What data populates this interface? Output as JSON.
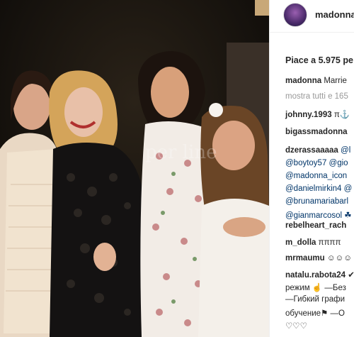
{
  "post": {
    "username": "madonna",
    "likes": "Piace a 5.975 pe",
    "caption_user": "madonna",
    "caption_text": "Marrie",
    "show_all": "mostra tutti e 165"
  },
  "comments": [
    {
      "user": "johnny.1993",
      "text": "π⚓"
    },
    {
      "user": "bigassmadonna",
      "text": ""
    },
    {
      "user": "dzerassaaaaa",
      "text": "@l"
    },
    {
      "user": "",
      "text": "@boytoy57 @gio"
    },
    {
      "user": "",
      "text": "@madonna_icon"
    },
    {
      "user": "",
      "text": "@danielmirkin4 @"
    },
    {
      "user": "",
      "text": "@brunamariabarl"
    },
    {
      "user": "",
      "text": "@gianmarcosol ☘"
    },
    {
      "user": "rebelheart_rach",
      "text": ""
    },
    {
      "user": "m_dolla",
      "text": "ππππ"
    },
    {
      "user": "mrmaumu",
      "text": "☺☺☺"
    },
    {
      "user": "natalu.rabota24",
      "text": "✔"
    },
    {
      "user": "",
      "text": "режим ☝ —Без"
    },
    {
      "user": "",
      "text": "—Гибкий графи"
    },
    {
      "user": "",
      "text": "обучение⚑ —О"
    },
    {
      "user": "",
      "text": "♡♡♡"
    }
  ],
  "watermark": "per line"
}
